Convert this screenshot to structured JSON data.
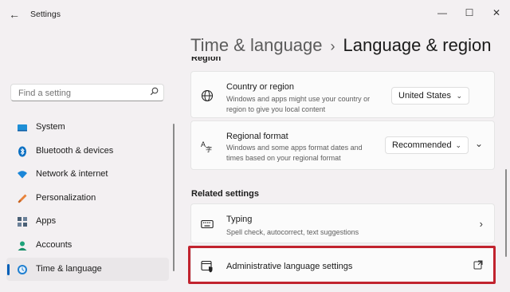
{
  "window": {
    "app_title": "Settings",
    "back_icon": "back-arrow-icon",
    "min_glyph": "—",
    "max_glyph": "☐",
    "close_glyph": "✕"
  },
  "breadcrumb": {
    "parent": "Time & language",
    "separator": "›",
    "current": "Language & region"
  },
  "search": {
    "placeholder": "Find a setting",
    "icon": "search-icon"
  },
  "sidebar": {
    "items": [
      {
        "label": "System",
        "icon": "system-icon",
        "active": false
      },
      {
        "label": "Bluetooth & devices",
        "icon": "bluetooth-icon",
        "active": false
      },
      {
        "label": "Network & internet",
        "icon": "network-icon",
        "active": false
      },
      {
        "label": "Personalization",
        "icon": "personalization-icon",
        "active": false
      },
      {
        "label": "Apps",
        "icon": "apps-icon",
        "active": false
      },
      {
        "label": "Accounts",
        "icon": "accounts-icon",
        "active": false
      },
      {
        "label": "Time & language",
        "icon": "time-language-icon",
        "active": true
      }
    ]
  },
  "region": {
    "section_title": "Region",
    "country": {
      "title": "Country or region",
      "desc_line1": "Windows and apps might use your country or",
      "desc_line2": "region to give you local content",
      "value": "United States"
    },
    "regional_format": {
      "title": "Regional format",
      "desc_line1": "Windows and some apps format dates and",
      "desc_line2": "times based on your regional format",
      "value": "Recommended"
    }
  },
  "related": {
    "section_title": "Related settings",
    "typing": {
      "title": "Typing",
      "desc": "Spell check, autocorrect, text suggestions"
    },
    "admin": {
      "title": "Administrative language settings"
    }
  },
  "colors": {
    "accent": "#005fb8",
    "highlight": "#c1232e",
    "background": "#f3f0f2",
    "card": "#fbfbfb"
  }
}
